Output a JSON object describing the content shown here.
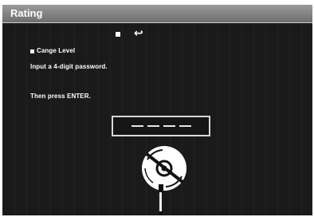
{
  "window": {
    "title": "Rating"
  },
  "icons": {
    "stop": "stop-square-icon",
    "return": "return-arrow-icon",
    "disc": "disc-icon",
    "pin": "remote-pin-icon"
  },
  "return_glyph": "↩",
  "rating": {
    "level_label": "Cange Level",
    "instruction_1": "Input a 4-digit password.",
    "instruction_2": "Then press ENTER."
  },
  "password": {
    "digits_entered": 0,
    "digits_total": 4
  }
}
